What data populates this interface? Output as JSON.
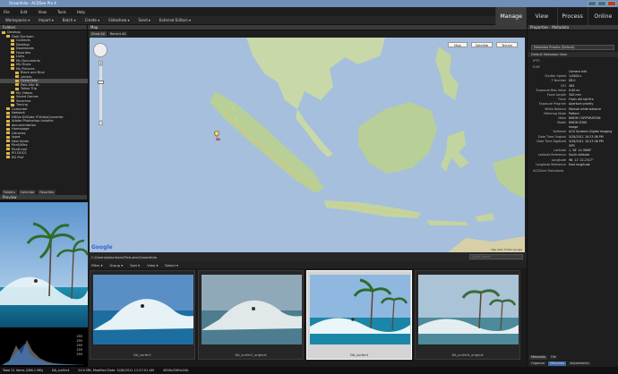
{
  "window": {
    "title": "Oceanfolio - ACDSee Pro 4"
  },
  "menu": [
    "File",
    "Edit",
    "View",
    "Tools",
    "Help"
  ],
  "toolbar": [
    "Workspaces ▾",
    "Import ▾",
    "Batch ▾",
    "Create ▾",
    "Slideshow ▾",
    "Send ▾",
    "External Editors ▾"
  ],
  "modes": [
    {
      "label": "Manage",
      "active": true
    },
    {
      "label": "View",
      "active": false
    },
    {
      "label": "Process",
      "active": false
    },
    {
      "label": "Online",
      "active": false
    }
  ],
  "folders": {
    "title": "Folders",
    "items": [
      {
        "label": "Desktop",
        "depth": 0,
        "selected": false
      },
      {
        "label": "Dale Dunham",
        "depth": 1,
        "selected": false
      },
      {
        "label": "Contacts",
        "depth": 2,
        "selected": false
      },
      {
        "label": "Desktop",
        "depth": 2,
        "selected": false
      },
      {
        "label": "Downloads",
        "depth": 2,
        "selected": false
      },
      {
        "label": "Favorites",
        "depth": 2,
        "selected": false
      },
      {
        "label": "Links",
        "depth": 2,
        "selected": false
      },
      {
        "label": "My Documents",
        "depth": 2,
        "selected": false
      },
      {
        "label": "My Music",
        "depth": 2,
        "selected": false
      },
      {
        "label": "My Pictures",
        "depth": 2,
        "selected": false
      },
      {
        "label": "Black and Blue",
        "depth": 3,
        "selected": false
      },
      {
        "label": "Lenses",
        "depth": 3,
        "selected": false
      },
      {
        "label": "Oceanfolio",
        "depth": 3,
        "selected": true
      },
      {
        "label": "Palo Alto Br.",
        "depth": 3,
        "selected": false
      },
      {
        "label": "Tahoe Trip",
        "depth": 3,
        "selected": false
      },
      {
        "label": "My Videos",
        "depth": 2,
        "selected": false
      },
      {
        "label": "Saved Games",
        "depth": 2,
        "selected": false
      },
      {
        "label": "Searches",
        "depth": 2,
        "selected": false
      },
      {
        "label": "Tracing",
        "depth": 2,
        "selected": false
      },
      {
        "label": "Computer",
        "depth": 1,
        "selected": false
      },
      {
        "label": "Network",
        "depth": 1,
        "selected": false
      },
      {
        "label": "DRiVe.DVDate ITVideoConverter",
        "depth": 1,
        "selected": false
      },
      {
        "label": "Adobe Photoshop installer",
        "depth": 1,
        "selected": false
      },
      {
        "label": "documentation",
        "depth": 1,
        "selected": false
      },
      {
        "label": "Homepage",
        "depth": 1,
        "selected": false
      },
      {
        "label": "Libraries",
        "depth": 1,
        "selected": false
      },
      {
        "label": "logos",
        "depth": 1,
        "selected": false
      },
      {
        "label": "New folder",
        "depth": 1,
        "selected": false
      },
      {
        "label": "Pics&Misc",
        "depth": 1,
        "selected": false
      },
      {
        "label": "PicsEmail",
        "depth": 1,
        "selected": false
      },
      {
        "label": "PO DOCS",
        "depth": 1,
        "selected": false
      },
      {
        "label": "RG Prof",
        "depth": 1,
        "selected": false
      }
    ],
    "tabs": [
      "Folders",
      "Calendar",
      "Favorites"
    ]
  },
  "preview": {
    "title": "Preview",
    "histogram_values": [
      "255",
      "255",
      "255",
      "255",
      "255"
    ]
  },
  "map": {
    "title": "Map",
    "tabs": [
      "Show All",
      "Recent All"
    ],
    "type_buttons": [
      "Map",
      "Satellite",
      "Terrain"
    ],
    "marker_label": "58",
    "logo": "Google",
    "attribution": "Map data ©2011 Google"
  },
  "filelist": {
    "path": "C:\\Users\\ddunham\\Pictures\\Oceanfolio",
    "search_placeholder": "Quick Search",
    "tools": [
      "Filter ▾",
      "Group ▾",
      "Sort ▾",
      "View ▾",
      "Select ▾"
    ],
    "thumbnails": [
      {
        "label": "DA_surfer2",
        "selected": false
      },
      {
        "label": "DA_surfer2_original",
        "selected": false
      },
      {
        "label": "DA_surfer4",
        "selected": true
      },
      {
        "label": "DA_surfer4_original",
        "selected": false
      }
    ]
  },
  "properties": {
    "title": "Properties - Metadata",
    "preset": "Metadata Presets (Default)",
    "view_label": "Default Metadata View",
    "sections": [
      "IPTC",
      "EXIF",
      "ACDSee Metadata"
    ],
    "exif": [
      {
        "k": "",
        "v": "Camera Info"
      },
      {
        "k": "Shutter Speed",
        "v": "1/2000 s"
      },
      {
        "k": "F Number",
        "v": "f/8.0"
      },
      {
        "k": "ISO",
        "v": "400"
      },
      {
        "k": "Exposure Bias Value",
        "v": "0.00 ev"
      },
      {
        "k": "Focal Length",
        "v": "300 mm"
      },
      {
        "k": "Flash",
        "v": "Flash did not fire"
      },
      {
        "k": "Exposure Program",
        "v": "Aperture priority"
      },
      {
        "k": "White Balance",
        "v": "Manual white balance"
      },
      {
        "k": "Metering Mode",
        "v": "Pattern"
      },
      {
        "k": "Make",
        "v": "NIKON CORPORATION"
      },
      {
        "k": "Model",
        "v": "NIKON D300"
      },
      {
        "k": "",
        "v": "Image"
      },
      {
        "k": "Software",
        "v": "ACD Systems Digital Imaging"
      },
      {
        "k": "Date Time Original",
        "v": "5/28/2011 10:23:36 PM"
      },
      {
        "k": "Date Time Digitized",
        "v": "5/28/2011 10:23:36 PM"
      },
      {
        "k": "",
        "v": "GPS"
      },
      {
        "k": "Latitude",
        "v": "1, 58' 14.3808\""
      },
      {
        "k": "Latitude Reference",
        "v": "South latitude"
      },
      {
        "k": "Longitude",
        "v": "96, 11' 22.2317\""
      },
      {
        "k": "Longitude Reference",
        "v": "East longitude"
      }
    ],
    "tabs": [
      "Metadata",
      "File"
    ],
    "bottom_tabs": [
      "Organize",
      "Metadata",
      "Adjustments"
    ]
  },
  "status": [
    "Total 21 items (286.1 MB)",
    "DA_surfer4",
    "24.0 MB, Modified Date: 5/28/2011 11:27:01 AM",
    "4928x3280x24b"
  ]
}
